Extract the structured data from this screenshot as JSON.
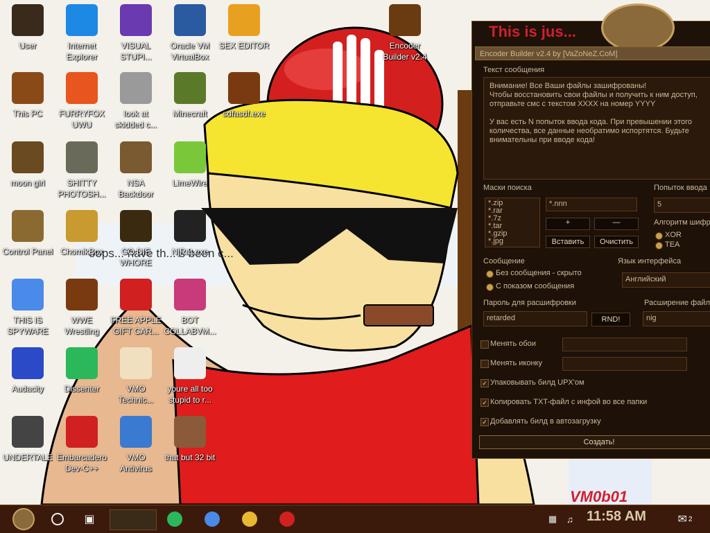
{
  "desktop": {
    "icons": [
      {
        "label": "User",
        "icon": "skull-avatar-icon",
        "color": "#3a2a1c"
      },
      {
        "label": "Internet Explorer",
        "icon": "edge-browser-icon",
        "color": "#1e88e5"
      },
      {
        "label": "VISUAL STUPI...",
        "icon": "visual-studio-icon",
        "color": "#6a3ab0"
      },
      {
        "label": "Oracle VM VirtualBox",
        "icon": "virtualbox-icon",
        "color": "#2a5aa0"
      },
      {
        "label": "SEX EDITOR",
        "icon": "hex-editor-icon",
        "color": "#e8a020"
      },
      {
        "label": "This PC",
        "icon": "steampunk-computer-icon",
        "color": "#8a4a18"
      },
      {
        "label": "FURRYFOX UWU",
        "icon": "firefox-icon",
        "color": "#e8551e"
      },
      {
        "label": "look at skidded c...",
        "icon": "window-stack-icon",
        "color": "#9a9a9a"
      },
      {
        "label": "Minecraft",
        "icon": "minecraft-block-icon",
        "color": "#5a7a2a"
      },
      {
        "label": "sdfasdf.exe",
        "icon": "steampunk-app-icon",
        "color": "#7a3a10"
      },
      {
        "label": "moon girl",
        "icon": "wooden-barrel-icon",
        "color": "#6a4a20"
      },
      {
        "label": "SHITTY PHOTOSH...",
        "icon": "gimp-icon",
        "color": "#6a6a5a"
      },
      {
        "label": "NSA Backdoor",
        "icon": "steampunk-folder-icon",
        "color": "#7a5a30"
      },
      {
        "label": "LimeWire",
        "icon": "limewire-icon",
        "color": "#7ac83a"
      },
      {
        "label": "Control Panel",
        "icon": "lightbulb-icon",
        "color": "#8a6a30"
      },
      {
        "label": "ChomikBox",
        "icon": "chomikbox-icon",
        "color": "#c89a30"
      },
      {
        "label": "GO DIE WHORE",
        "icon": "adobe-dimension-icon",
        "color": "#3a2a10"
      },
      {
        "label": "NjRat.exe",
        "icon": "skull-crossbones-icon",
        "color": "#222222"
      },
      {
        "label": "THIS IS SPYWARE",
        "icon": "chrome-icon",
        "color": "#4a8ae8"
      },
      {
        "label": "WWE Wrestling",
        "icon": "steampunk-monitor-icon",
        "color": "#7a3a10"
      },
      {
        "label": "FREE APPLE GIFT CAR...",
        "icon": "red-apple-icon",
        "color": "#d02020"
      },
      {
        "label": "BOT COLLABVM...",
        "icon": "monitor-glare-icon",
        "color": "#c83a7a"
      },
      {
        "label": "Audacity",
        "icon": "audacity-headphones-icon",
        "color": "#2a4ac8"
      },
      {
        "label": "Dissenter",
        "icon": "dissenter-icon",
        "color": "#2ab85a"
      },
      {
        "label": "VMO Technic...",
        "icon": "doctor-avatar-icon",
        "color": "#f0e0c0"
      },
      {
        "label": "youre all too stupid to r...",
        "icon": "drawing-face-icon",
        "color": "#eeeeee"
      },
      {
        "label": "UNDERTALE",
        "icon": "unity-logo-icon",
        "color": "#444444"
      },
      {
        "label": "Embarcadero Dev-C++",
        "icon": "devcpp-icon",
        "color": "#d02020"
      },
      {
        "label": "VMO Antivirus",
        "icon": "windows-shield-icon",
        "color": "#3a7ad0"
      },
      {
        "label": "that but 32 bit",
        "icon": "portrait-painting-icon",
        "color": "#8a5a3a"
      },
      {
        "label": "Encoder Builder v2.4",
        "icon": "steampunk-book-icon",
        "color": "#6a3a10"
      }
    ],
    "background_text": "oops... have th... s been c..."
  },
  "encoder_window": {
    "title": "Encoder Builder v2.4 by [VaZoNeZ.CoM]",
    "top_text": "This is jus...",
    "message_section_label": "Текст сообщения",
    "message_text": "Внимание! Все Ваши файлы зашифрованы!\nЧтобы восстановить свои файлы и получить к ним доступ, отправьте смс с текстом XXXX на номер YYYY\n\nУ вас есть N попыток ввода кода. При превышении этого количества, все данные необратимо испортятся. Будьте внимательны при вводе кода!",
    "search_masks_label": "Маски поиска",
    "masks": [
      "*.zip",
      "*.rar",
      "*.7z",
      "*.tar",
      "*.gzip",
      "*.jpg"
    ],
    "mask_input": "*.nnn",
    "add_button": "+",
    "remove_button": "—",
    "paste_button": "Вставить",
    "clear_button": "Очистить",
    "attempts_label": "Попыток ввода",
    "attempts_value": "5",
    "algorithm_label": "Алгоритм шифр",
    "algorithms": [
      "XOR",
      "TEA"
    ],
    "message_mode_label": "Сообщение",
    "message_modes": [
      "Без сообщения - скрыто",
      "С показом сообщения"
    ],
    "interface_language_label": "Язык интерфейса",
    "interface_language_value": "Английский",
    "password_label": "Пароль для расшифровки",
    "password_value": "retarded",
    "rnd_button": "RND!",
    "extension_label": "Расширение файло",
    "extension_value": "nig",
    "checkboxes": [
      {
        "label": "Менять обои",
        "checked": false
      },
      {
        "label": "Менять иконку",
        "checked": false
      },
      {
        "label": "Упаковывать билд UPX'ом",
        "checked": true
      },
      {
        "label": "Копировать TXT-файл с инфой во все папки",
        "checked": true
      },
      {
        "label": "Добавлять билд в автозагрузку",
        "checked": true
      }
    ],
    "create_button": "Создать!"
  },
  "background_window": {
    "watermark": "VM0b01"
  },
  "taskbar": {
    "start_icon": "steampunk-start-icon",
    "search_icon": "cortana-circle-icon",
    "task_view_icon": "task-view-icon",
    "pinned": [
      {
        "icon": "dissenter-icon",
        "color": "#2ab85a"
      },
      {
        "icon": "chrome-icon",
        "color": "#4a8ae8"
      },
      {
        "icon": "file-explorer-icon",
        "color": "#e8b830"
      },
      {
        "icon": "red-apple-icon",
        "color": "#d02020"
      }
    ],
    "tray_icons": [
      "network-icon",
      "volume-muted-icon"
    ],
    "time": "11:58 AM",
    "notification_count": "2"
  },
  "colors": {
    "taskbar_bg": "#3b1a0c",
    "window_bg": "#1d1108",
    "accent_gold": "#c8a050"
  }
}
